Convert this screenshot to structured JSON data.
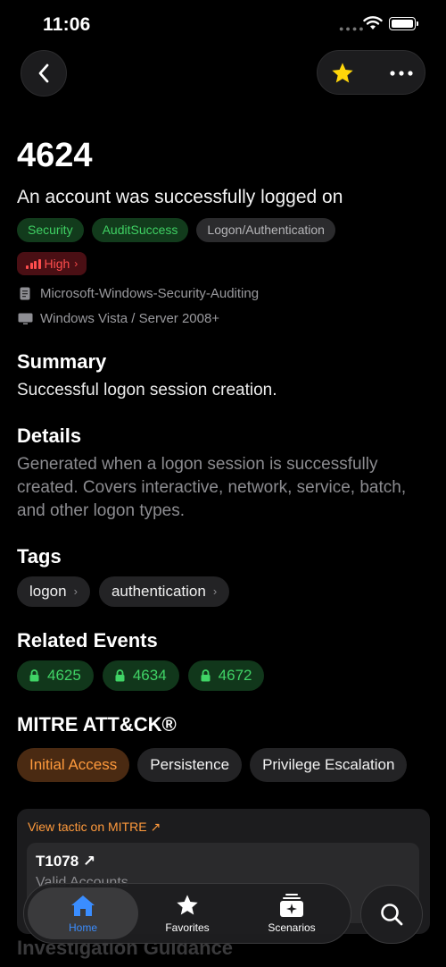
{
  "status_bar": {
    "time": "11:06"
  },
  "event": {
    "id": "4624",
    "title": "An account was successfully logged on",
    "badges": [
      "Security",
      "AuditSuccess",
      "Logon/Authentication"
    ],
    "severity": "High",
    "provider": "Microsoft-Windows-Security-Auditing",
    "platform": "Windows Vista / Server 2008+"
  },
  "summary": {
    "heading": "Summary",
    "text": "Successful logon session creation."
  },
  "details": {
    "heading": "Details",
    "text": "Generated when a logon session is successfully created. Covers interactive, network, service, batch, and other logon types."
  },
  "tags": {
    "heading": "Tags",
    "items": [
      "logon",
      "authentication"
    ]
  },
  "related": {
    "heading": "Related Events",
    "items": [
      "4625",
      "4634",
      "4672"
    ]
  },
  "mitre": {
    "heading": "MITRE ATT&CK®",
    "tactics": [
      "Initial Access",
      "Persistence",
      "Privilege Escalation"
    ],
    "view_link": "View tactic on MITRE ↗",
    "technique_id": "T1078 ↗",
    "technique_name": "Valid Accounts"
  },
  "next_section": "Investigation Guidance",
  "tabbar": {
    "home": "Home",
    "favorites": "Favorites",
    "scenarios": "Scenarios"
  },
  "colors": {
    "accent_orange": "#ff9a3c",
    "green": "#3fd063",
    "red": "#ff4d4d",
    "blue": "#3a8dff",
    "star": "#ffd60a"
  },
  "icons": [
    "back-chevron-icon",
    "star-icon",
    "more-icon",
    "document-icon",
    "monitor-icon",
    "lock-icon",
    "house-icon",
    "search-icon"
  ]
}
